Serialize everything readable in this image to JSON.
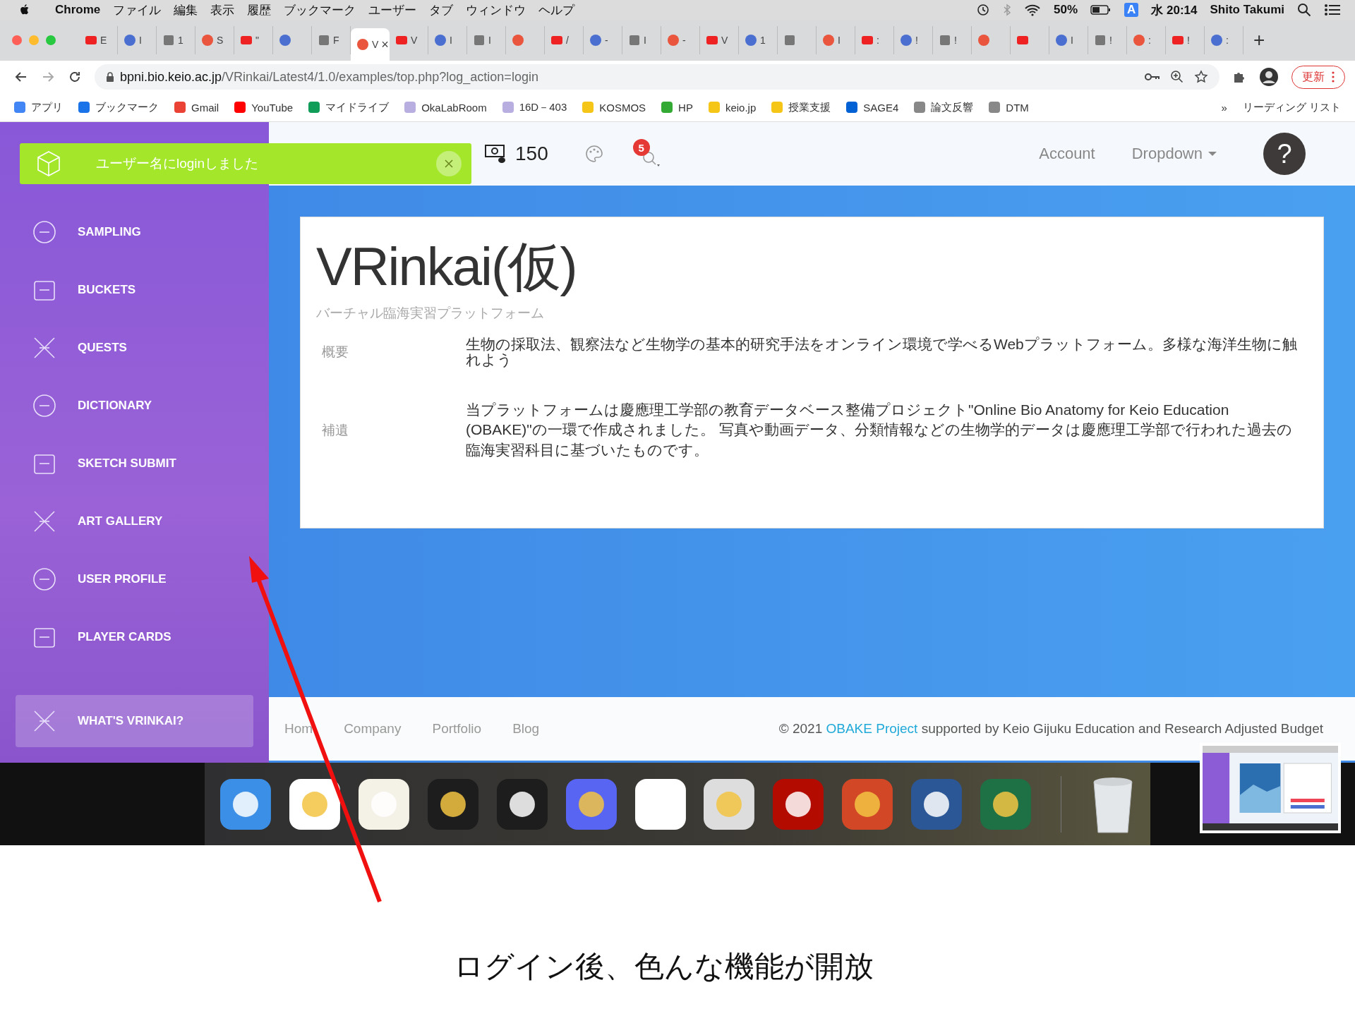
{
  "menu_bar": {
    "app": "Chrome",
    "items": [
      "ファイル",
      "編集",
      "表示",
      "履歴",
      "ブックマーク",
      "ユーザー",
      "タブ",
      "ウィンドウ",
      "ヘルプ"
    ],
    "battery": "50%",
    "input_mode": "A",
    "clock": "水 20:14",
    "user": "Shito Takumi"
  },
  "tabs": [
    {
      "title": "E",
      "selected": false
    },
    {
      "title": "I",
      "selected": false
    },
    {
      "title": "1",
      "selected": false
    },
    {
      "title": "S",
      "selected": false
    },
    {
      "title": "\"",
      "selected": false
    },
    {
      "selected": false
    },
    {
      "title": "F",
      "selected": false
    },
    {
      "title": "V",
      "selected": true
    },
    {
      "title": "V",
      "selected": false
    },
    {
      "title": "I",
      "selected": false
    },
    {
      "title": "I",
      "selected": false
    },
    {
      "selected": false
    },
    {
      "title": "/",
      "selected": false
    },
    {
      "title": "-",
      "selected": false
    },
    {
      "title": "I",
      "selected": false
    },
    {
      "title": "-",
      "selected": false
    },
    {
      "title": "V",
      "selected": false
    },
    {
      "title": "1",
      "selected": false
    },
    {
      "selected": false
    },
    {
      "title": "I",
      "selected": false
    },
    {
      "title": ":",
      "selected": false
    },
    {
      "title": "!",
      "selected": false
    },
    {
      "title": "!",
      "selected": false
    },
    {
      "selected": false
    },
    {
      "selected": false
    },
    {
      "title": "I",
      "selected": false
    },
    {
      "title": "!",
      "selected": false
    },
    {
      "title": ":",
      "selected": false
    },
    {
      "title": "!",
      "selected": false
    },
    {
      "title": ":",
      "selected": false
    }
  ],
  "tab_close": "×",
  "new_tab": "+",
  "address_bar": {
    "host": "bpni.bio.keio.ac.jp",
    "path": "/VRinkai/Latest4/1.0/examples/top.php?log_action=login",
    "update_button": "更新"
  },
  "bookmarks": [
    "アプリ",
    "ブックマーク",
    "Gmail",
    "YouTube",
    "マイドライブ",
    "OkaLabRoom",
    "16D－403",
    "KOSMOS",
    "HP",
    "keio.jp",
    "授業支援",
    "SAGE4",
    "論文反響",
    "DTM"
  ],
  "bookmarks_more": "»",
  "reading_list": "リーディング リスト",
  "toast": {
    "message": "ユーザー名にloginしました"
  },
  "top_bar": {
    "coins": "150",
    "notifications": "5",
    "links": [
      "Account",
      "Dropdown"
    ],
    "help": "?"
  },
  "sidebar": {
    "items": [
      {
        "label": "SAMPLING",
        "selected": false
      },
      {
        "label": "BUCKETS",
        "selected": false
      },
      {
        "label": "QUESTS",
        "selected": false
      },
      {
        "label": "DICTIONARY",
        "selected": false
      },
      {
        "label": "SKETCH SUBMIT",
        "selected": false
      },
      {
        "label": "ART GALLERY",
        "selected": false
      },
      {
        "label": "USER PROFILE",
        "selected": false
      },
      {
        "label": "PLAYER CARDS",
        "selected": false
      },
      {
        "label": "WHAT'S VRINKAI?",
        "selected": true
      }
    ]
  },
  "card": {
    "title": "VRinkai(仮)",
    "subtitle": "バーチャル臨海実習プラットフォーム",
    "rows": [
      {
        "label": "概要",
        "text": "生物の採取法、観察法など生物学の基本的研究手法をオンライン環境で学べるWebプラットフォーム。多様な海洋生物に触れよう"
      },
      {
        "label": "補遺",
        "text": "当プラットフォームは慶應理工学部の教育データベース整備プロジェクト\"Online Bio Anatomy for Keio Education (OBAKE)\"の一環で作成されました。 写真や動画データ、分類情報などの生物学的データは慶應理工学部で行われた過去の臨海実習科目に基づいたものです。"
      }
    ]
  },
  "footer": {
    "links": [
      "Hom",
      "Company",
      "Portfolio",
      "Blog"
    ],
    "copyright": "© 2021",
    "project_link": "OBAKE Project",
    "credit": "supported by Keio Gijuku Education and Research Adjusted Budget"
  },
  "annotation": "ログイン後、色んな機能が開放"
}
